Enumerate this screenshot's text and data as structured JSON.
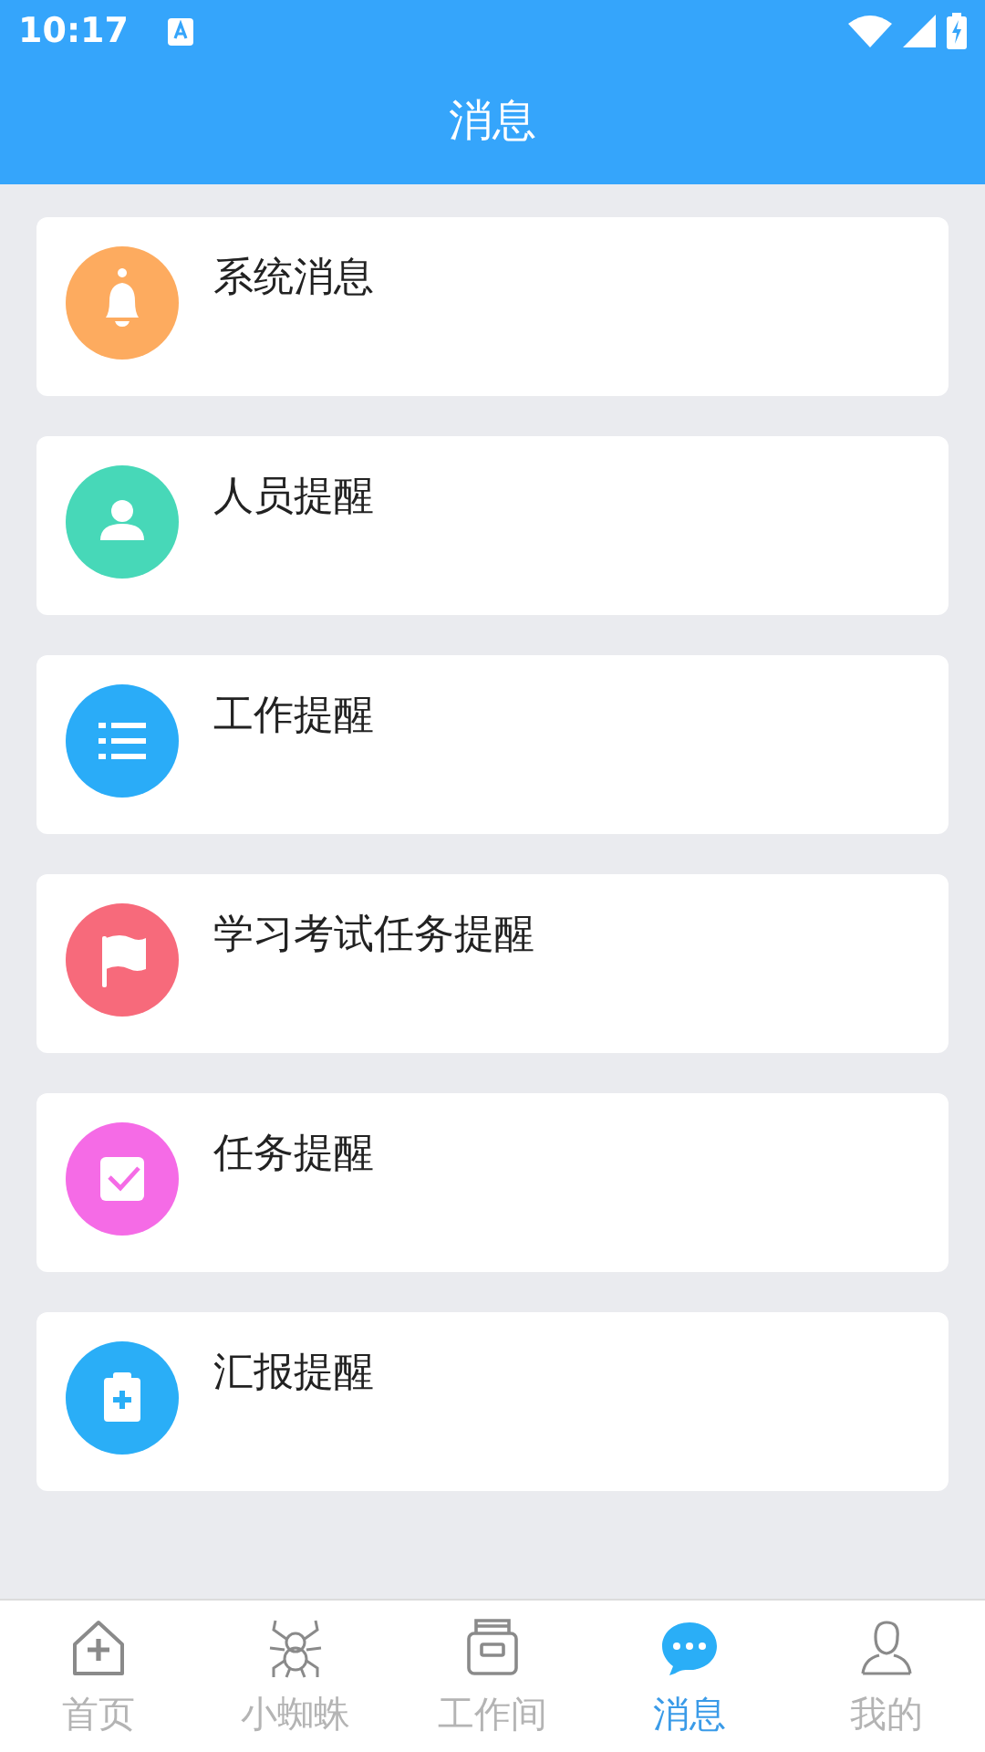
{
  "status_bar": {
    "time": "10:17"
  },
  "header": {
    "title": "消息"
  },
  "messages": [
    {
      "label": "系统消息",
      "kind": "bell",
      "color": "#fdab5f"
    },
    {
      "label": "人员提醒",
      "kind": "person",
      "color": "#47d8b8"
    },
    {
      "label": "工作提醒",
      "kind": "list",
      "color": "#2aacf8"
    },
    {
      "label": "学习考试任务提醒",
      "kind": "flag",
      "color": "#f76a7b"
    },
    {
      "label": "任务提醒",
      "kind": "check",
      "color": "#f56be6"
    },
    {
      "label": "汇报提醒",
      "kind": "clipboard",
      "color": "#2aaef7"
    }
  ],
  "tab_bar": [
    {
      "label": "首页",
      "kind": "home",
      "selected": false
    },
    {
      "label": "小蜘蛛",
      "kind": "spider",
      "selected": false
    },
    {
      "label": "工作间",
      "kind": "box",
      "selected": false
    },
    {
      "label": "消息",
      "kind": "chat",
      "selected": true
    },
    {
      "label": "我的",
      "kind": "user",
      "selected": false
    }
  ]
}
